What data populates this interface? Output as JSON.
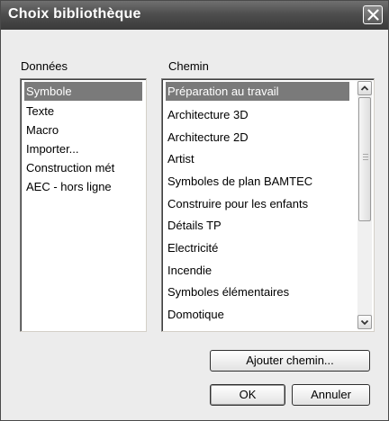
{
  "window": {
    "title": "Choix bibliothèque"
  },
  "donnees": {
    "label": "Données",
    "items": [
      "Symbole",
      "Texte",
      "Macro",
      "Importer...",
      "Construction mét",
      "AEC - hors ligne"
    ],
    "selected_index": 0
  },
  "chemin": {
    "label": "Chemin",
    "items": [
      "Préparation au travail",
      "Architecture 3D",
      "Architecture 2D",
      "Artist",
      "Symboles de plan BAMTEC",
      "Construire pour les enfants",
      "Détails TP",
      "Electricité",
      "Incendie",
      "Symboles élémentaires",
      "Domotique"
    ],
    "selected_index": 0
  },
  "buttons": {
    "add_path": "Ajouter chemin...",
    "ok": "OK",
    "cancel": "Annuler"
  },
  "icons": {
    "close": "close-icon",
    "scroll_up": "chevron-up-icon",
    "scroll_down": "chevron-down-icon"
  },
  "colors": {
    "selection_bg": "#7a7a7a",
    "titlebar": "#4e4e4e"
  }
}
